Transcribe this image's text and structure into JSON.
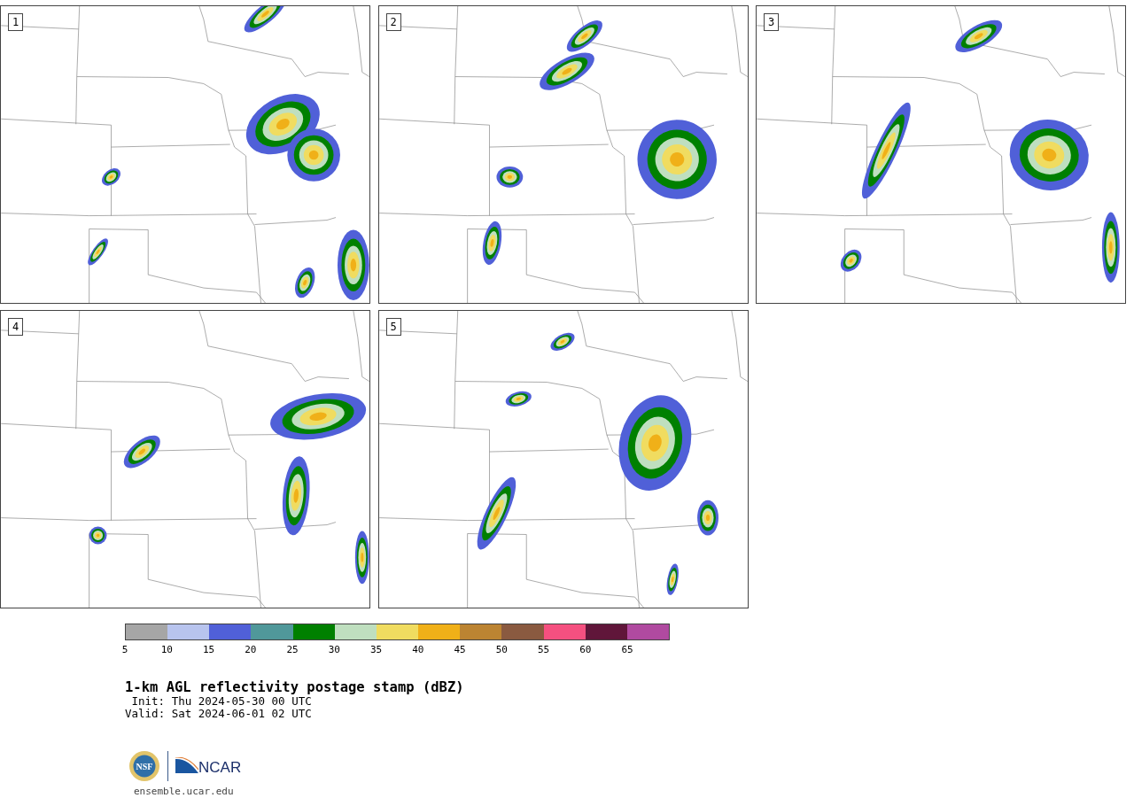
{
  "panels": [
    {
      "label": "1"
    },
    {
      "label": "2"
    },
    {
      "label": "3"
    },
    {
      "label": "4"
    },
    {
      "label": "5"
    }
  ],
  "colorbar": {
    "segments": [
      {
        "color": "#a6a6a6"
      },
      {
        "color": "#b8c4ee"
      },
      {
        "color": "#5060d8"
      },
      {
        "color": "#50989a"
      },
      {
        "color": "#008000"
      },
      {
        "color": "#bfdfbf"
      },
      {
        "color": "#f0dc60"
      },
      {
        "color": "#f0b018"
      },
      {
        "color": "#bc8432"
      },
      {
        "color": "#8a5a40"
      },
      {
        "color": "#f55080"
      },
      {
        "color": "#60163a"
      },
      {
        "color": "#b04aa0"
      }
    ],
    "ticks": [
      "5",
      "10",
      "15",
      "20",
      "25",
      "30",
      "35",
      "40",
      "45",
      "50",
      "55",
      "60",
      "65"
    ]
  },
  "title": "1-km AGL reflectivity postage stamp (dBZ)",
  "init": "Init: Thu 2024-05-30 00 UTC",
  "valid": "Valid: Sat 2024-06-01 02 UTC",
  "logos": {
    "nsf": "NSF",
    "ncar": "NCAR"
  },
  "footer": "ensemble.ucar.edu"
}
